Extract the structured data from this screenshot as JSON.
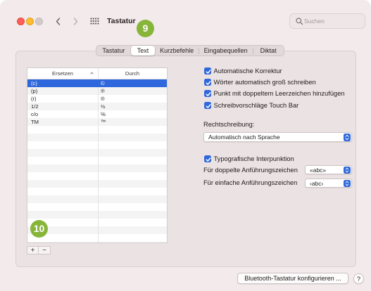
{
  "colors": {
    "accent": "#2f68dc",
    "badge": "#87b53a",
    "close": "#fe5f57",
    "minimize": "#febc2e",
    "zoom": "#d3cacb"
  },
  "toolbar": {
    "title": "Tastatur",
    "back_icon": "chevron-left-icon",
    "forward_icon": "chevron-right-icon",
    "show_all_icon": "grid-icon",
    "search": {
      "icon": "magnifying-glass-icon",
      "placeholder": "Suchen"
    }
  },
  "tabs": [
    {
      "label": "Tastatur",
      "selected": false
    },
    {
      "label": "Text",
      "selected": true
    },
    {
      "label": "Kurzbefehle",
      "selected": false
    },
    {
      "label": "Eingabequellen",
      "selected": false
    },
    {
      "label": "Diktat",
      "selected": false
    }
  ],
  "callouts": [
    "9",
    "10"
  ],
  "replacements": {
    "headers": {
      "replace": "Ersetzen",
      "with": "Durch"
    },
    "sort_icon": "chevron-up-icon",
    "rows": [
      {
        "replace": "(c)",
        "with": "©",
        "selected": true
      },
      {
        "replace": "(p)",
        "with": "℗",
        "selected": false
      },
      {
        "replace": "(r)",
        "with": "®",
        "selected": false
      },
      {
        "replace": "1/2",
        "with": "½",
        "selected": false
      },
      {
        "replace": "c/o",
        "with": "℅",
        "selected": false
      },
      {
        "replace": "TM",
        "with": "™",
        "selected": false
      }
    ],
    "add_button": "+",
    "remove_button": "−"
  },
  "options": {
    "check_icon": "checkmark-icon",
    "popup_icon": "up-down-chevron-icon",
    "autocorrect": {
      "label": "Automatische Korrektur",
      "checked": true
    },
    "capitalize": {
      "label": "Wörter automatisch groß schreiben",
      "checked": true
    },
    "double_space_period": {
      "label": "Punkt mit doppeltem Leerzeichen hinzufügen",
      "checked": true
    },
    "touch_bar_suggestions": {
      "label": "Schreibvorschläge Touch Bar",
      "checked": true
    },
    "spelling": {
      "label": "Rechtschreibung:",
      "value": "Automatisch nach Sprache"
    },
    "smart_quotes": {
      "label": "Typografische Interpunktion",
      "checked": true
    },
    "double_quotes": {
      "label": "Für doppelte Anführungszeichen",
      "value": "«abc»"
    },
    "single_quotes": {
      "label": "Für einfache Anführungszeichen",
      "value": "‹abc›"
    }
  },
  "footer": {
    "bluetooth_button": "Bluetooth-Tastatur konfigurieren ...",
    "help_button": "?"
  }
}
